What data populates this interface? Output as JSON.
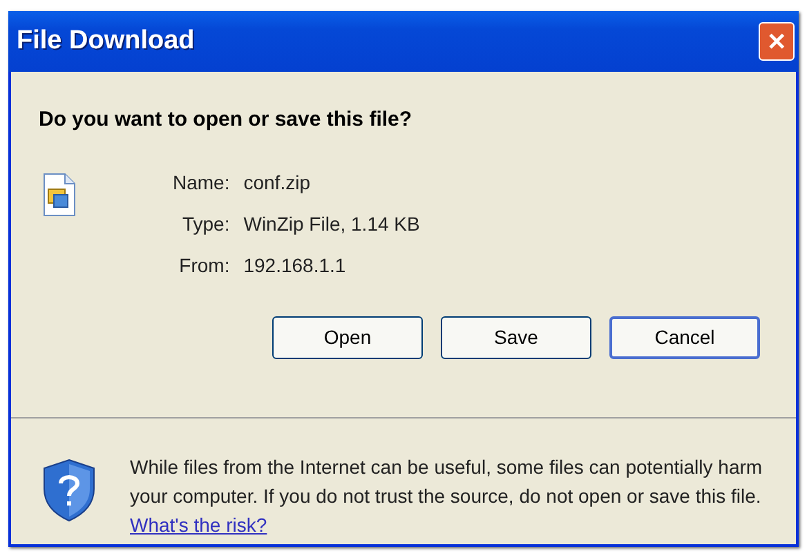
{
  "window": {
    "title": "File Download",
    "close": "✕"
  },
  "question": "Do you want to open or save this file?",
  "fields": [
    {
      "label": "Name:",
      "value": "conf.zip"
    },
    {
      "label": "Type:",
      "value": "WinZip File, 1.14 KB"
    },
    {
      "label": "From:",
      "value": "192.168.1.1"
    }
  ],
  "buttons": [
    {
      "label": "Open",
      "focused": false
    },
    {
      "label": "Save",
      "focused": false
    },
    {
      "label": "Cancel",
      "focused": true
    }
  ],
  "warning": {
    "text": "While files from the Internet can be useful, some files can potentially harm your computer. If you do not trust the source, do not open or save this file.",
    "link": "What's the risk?"
  }
}
